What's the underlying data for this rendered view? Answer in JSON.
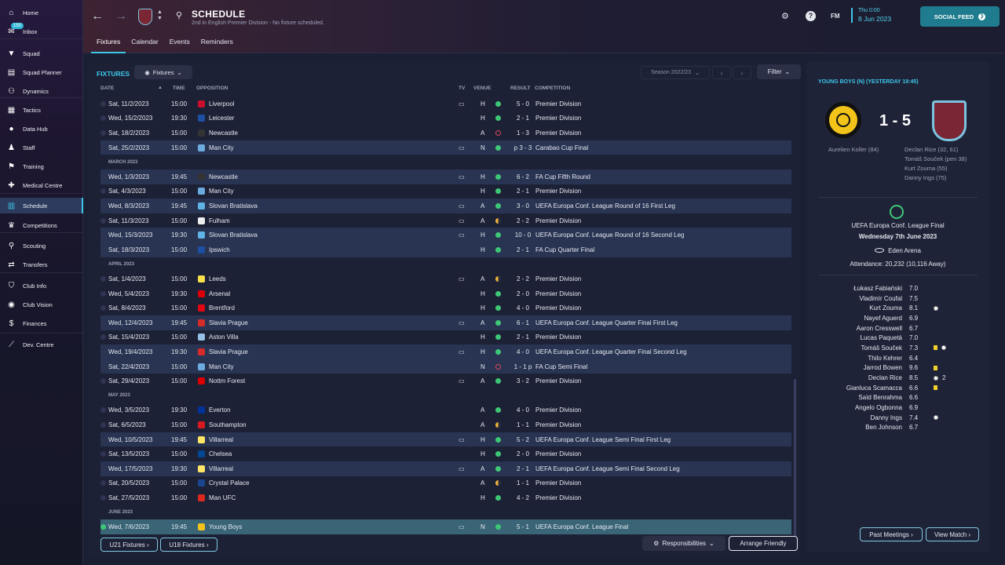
{
  "sidebar": {
    "items": [
      {
        "label": "Home",
        "icon": "home-icon"
      },
      {
        "label": "Inbox",
        "icon": "inbox-icon",
        "badge": "150"
      },
      {
        "label": "Squad",
        "icon": "shirt-icon"
      },
      {
        "label": "Squad Planner",
        "icon": "planner-icon"
      },
      {
        "label": "Dynamics",
        "icon": "dynamics-icon"
      },
      {
        "label": "Tactics",
        "icon": "tactics-icon"
      },
      {
        "label": "Data Hub",
        "icon": "data-hub-icon"
      },
      {
        "label": "Staff",
        "icon": "staff-icon"
      },
      {
        "label": "Training",
        "icon": "training-icon"
      },
      {
        "label": "Medical Centre",
        "icon": "medical-icon"
      },
      {
        "label": "Schedule",
        "icon": "calendar-icon",
        "active": true
      },
      {
        "label": "Competitions",
        "icon": "trophy-icon"
      },
      {
        "label": "Scouting",
        "icon": "scouting-icon"
      },
      {
        "label": "Transfers",
        "icon": "transfers-icon"
      },
      {
        "label": "Club Info",
        "icon": "shield-icon"
      },
      {
        "label": "Club Vision",
        "icon": "vision-icon"
      },
      {
        "label": "Finances",
        "icon": "finances-icon"
      },
      {
        "label": "Dev. Centre",
        "icon": "dev-centre-icon"
      }
    ]
  },
  "header": {
    "title": "SCHEDULE",
    "subtitle": "2nd in English Premier Division - No fixture scheduled.",
    "tabs": [
      "Fixtures",
      "Calendar",
      "Events",
      "Reminders"
    ],
    "fm_label": "FM",
    "time": "Thu 0:00",
    "date": "8 Jun 2023",
    "social_feed": "SOCIAL FEED"
  },
  "main": {
    "label": "FIXTURES",
    "dropdown": "Fixtures",
    "season": "Season 2022/23",
    "filter": "Filter",
    "columns": {
      "date": "DATE",
      "time": "TIME",
      "opposition": "OPPOSITION",
      "tv": "TV",
      "venue": "VENUE",
      "result": "RESULT",
      "competition": "COMPETITION"
    },
    "rows": [
      {
        "date": "Sat, 11/2/2023",
        "time": "15:00",
        "opp": "Liverpool",
        "tv": true,
        "venue": "H",
        "res": "win",
        "score": "5 - 0",
        "comp": "Premier Division",
        "crest": "#c8102e"
      },
      {
        "date": "Wed, 15/2/2023",
        "time": "19:30",
        "opp": "Leicester",
        "tv": false,
        "venue": "H",
        "res": "win",
        "score": "2 - 1",
        "comp": "Premier Division",
        "crest": "#1d4fa3"
      },
      {
        "date": "Sat, 18/2/2023",
        "time": "15:00",
        "opp": "Newcastle",
        "tv": false,
        "venue": "A",
        "res": "loss",
        "score": "1 - 3",
        "comp": "Premier Division",
        "crest": "#333333"
      },
      {
        "date": "Sat, 25/2/2023",
        "time": "15:00",
        "opp": "Man City",
        "tv": true,
        "venue": "N",
        "res": "win",
        "score": "p 3 - 3",
        "comp": "Carabao Cup Final",
        "crest": "#6cabdd"
      },
      {
        "month": "MARCH 2023"
      },
      {
        "date": "Wed, 1/3/2023",
        "time": "19:45",
        "opp": "Newcastle",
        "tv": true,
        "venue": "H",
        "res": "win",
        "score": "6 - 2",
        "comp": "FA Cup Fifth Round",
        "crest": "#333333"
      },
      {
        "date": "Sat, 4/3/2023",
        "time": "15:00",
        "opp": "Man City",
        "tv": false,
        "venue": "H",
        "res": "win",
        "score": "2 - 1",
        "comp": "Premier Division",
        "crest": "#6cabdd"
      },
      {
        "date": "Wed, 8/3/2023",
        "time": "19:45",
        "opp": "Slovan Bratislava",
        "tv": true,
        "venue": "A",
        "res": "win",
        "score": "3 - 0",
        "comp": "UEFA Europa Conf. League Round of 16  First Leg",
        "crest": "#5fb4e5"
      },
      {
        "date": "Sat, 11/3/2023",
        "time": "15:00",
        "opp": "Fulham",
        "tv": true,
        "venue": "A",
        "res": "draw",
        "score": "2 - 2",
        "comp": "Premier Division",
        "crest": "#eeeeee"
      },
      {
        "date": "Wed, 15/3/2023",
        "time": "19:30",
        "opp": "Slovan Bratislava",
        "tv": true,
        "venue": "H",
        "res": "win",
        "score": "10 - 0",
        "comp": "UEFA Europa Conf. League Round of 16  Second Leg",
        "crest": "#5fb4e5"
      },
      {
        "date": "Sat, 18/3/2023",
        "time": "15:00",
        "opp": "Ipswich",
        "tv": false,
        "venue": "H",
        "res": "win",
        "score": "2 - 1",
        "comp": "FA Cup Quarter Final",
        "crest": "#1d4fa3"
      },
      {
        "month": "APRIL 2023"
      },
      {
        "date": "Sat, 1/4/2023",
        "time": "15:00",
        "opp": "Leeds",
        "tv": true,
        "venue": "A",
        "res": "draw",
        "score": "2 - 2",
        "comp": "Premier Division",
        "crest": "#f5e04a"
      },
      {
        "date": "Wed, 5/4/2023",
        "time": "19:30",
        "opp": "Arsenal",
        "tv": false,
        "venue": "H",
        "res": "win",
        "score": "2 - 0",
        "comp": "Premier Division",
        "crest": "#db0007"
      },
      {
        "date": "Sat, 8/4/2023",
        "time": "15:00",
        "opp": "Brentford",
        "tv": false,
        "venue": "H",
        "res": "win",
        "score": "4 - 0",
        "comp": "Premier Division",
        "crest": "#e30613"
      },
      {
        "date": "Wed, 12/4/2023",
        "time": "19:45",
        "opp": "Slavia Prague",
        "tv": true,
        "venue": "A",
        "res": "win",
        "score": "6 - 1",
        "comp": "UEFA Europa Conf. League Quarter Final First Leg",
        "crest": "#d62b2b"
      },
      {
        "date": "Sat, 15/4/2023",
        "time": "15:00",
        "opp": "Aston Villa",
        "tv": false,
        "venue": "H",
        "res": "win",
        "score": "2 - 1",
        "comp": "Premier Division",
        "crest": "#95bfe5"
      },
      {
        "date": "Wed, 19/4/2023",
        "time": "19:30",
        "opp": "Slavia Prague",
        "tv": true,
        "venue": "H",
        "res": "win",
        "score": "4 - 0",
        "comp": "UEFA Europa Conf. League Quarter Final Second Leg",
        "crest": "#d62b2b"
      },
      {
        "date": "Sat, 22/4/2023",
        "time": "15:00",
        "opp": "Man City",
        "tv": false,
        "venue": "N",
        "res": "loss",
        "score": "1 - 1 p",
        "comp": "FA Cup Semi Final",
        "crest": "#6cabdd"
      },
      {
        "date": "Sat, 29/4/2023",
        "time": "15:00",
        "opp": "Nottm Forest",
        "tv": true,
        "venue": "A",
        "res": "win",
        "score": "3 - 2",
        "comp": "Premier Division",
        "crest": "#dd0000"
      },
      {
        "month": "MAY 2023"
      },
      {
        "date": "Wed, 3/5/2023",
        "time": "19:30",
        "opp": "Everton",
        "tv": false,
        "venue": "A",
        "res": "win",
        "score": "4 - 0",
        "comp": "Premier Division",
        "crest": "#003399"
      },
      {
        "date": "Sat, 6/5/2023",
        "time": "15:00",
        "opp": "Southampton",
        "tv": false,
        "venue": "A",
        "res": "draw",
        "score": "1 - 1",
        "comp": "Premier Division",
        "crest": "#d71920"
      },
      {
        "date": "Wed, 10/5/2023",
        "time": "19:45",
        "opp": "Villarreal",
        "tv": true,
        "venue": "H",
        "res": "win",
        "score": "5 - 2",
        "comp": "UEFA Europa Conf. League Semi Final First Leg",
        "crest": "#ffe667"
      },
      {
        "date": "Sat, 13/5/2023",
        "time": "15:00",
        "opp": "Chelsea",
        "tv": false,
        "venue": "H",
        "res": "win",
        "score": "2 - 0",
        "comp": "Premier Division",
        "crest": "#034694"
      },
      {
        "date": "Wed, 17/5/2023",
        "time": "19:30",
        "opp": "Villarreal",
        "tv": true,
        "venue": "A",
        "res": "win",
        "score": "2 - 1",
        "comp": "UEFA Europa Conf. League Semi Final Second Leg",
        "crest": "#ffe667"
      },
      {
        "date": "Sat, 20/5/2023",
        "time": "15:00",
        "opp": "Crystal Palace",
        "tv": false,
        "venue": "A",
        "res": "draw",
        "score": "1 - 1",
        "comp": "Premier Division",
        "crest": "#1b458f"
      },
      {
        "date": "Sat, 27/5/2023",
        "time": "15:00",
        "opp": "Man UFC",
        "tv": false,
        "venue": "H",
        "res": "win",
        "score": "4 - 2",
        "comp": "Premier Division",
        "crest": "#da291c"
      },
      {
        "month": "JUNE 2023"
      },
      {
        "date": "Wed, 7/6/2023",
        "time": "19:45",
        "opp": "Young Boys",
        "tv": true,
        "venue": "N",
        "res": "win",
        "score": "5 - 1",
        "comp": "UEFA Europa Conf. League Final",
        "crest": "#f2c419",
        "hl": true
      }
    ],
    "buttons": {
      "u21": "U21 Fixtures",
      "u18": "U18 Fixtures",
      "responsibilities": "Responsibilities",
      "arrange": "Arrange Friendly"
    }
  },
  "match": {
    "header": "YOUNG BOYS (N) (YESTERDAY 19:45)",
    "score": "1 - 5",
    "home_scorers": [
      "Aurelien Koller (84)"
    ],
    "away_scorers": [
      "Declan Rice (32, 61)",
      "Tomáš Souček (pen 38)",
      "Kurt Zouma (55)",
      "Danny Ings (75)"
    ],
    "competition": "UEFA Europa Conf. League Final",
    "date": "Wednesday 7th June 2023",
    "stadium": "Eden Arena",
    "attendance": "Attendance: 20,232 (10,116 Away)",
    "ratings": [
      {
        "name": "Łukasz Fabiański",
        "rating": "7.0"
      },
      {
        "name": "Vladimír Coufal",
        "rating": "7.5"
      },
      {
        "name": "Kurt Zouma",
        "rating": "8.1",
        "ball": true
      },
      {
        "name": "Nayef Aguerd",
        "rating": "6.9"
      },
      {
        "name": "Aaron Cresswell",
        "rating": "6.7"
      },
      {
        "name": "Lucas Paquetá",
        "rating": "7.0"
      },
      {
        "name": "Tomáš Souček",
        "rating": "7.3",
        "yellow": true,
        "ball": true
      },
      {
        "name": "Thilo Kehrer",
        "rating": "6.4"
      },
      {
        "name": "Jarrod Bowen",
        "rating": "9.6",
        "yellow": true
      },
      {
        "name": "Declan Rice",
        "rating": "8.5",
        "ball": true,
        "goals": "2"
      },
      {
        "name": "Gianluca Scamacca",
        "rating": "6.6",
        "yellow": true
      },
      {
        "name": "Saïd Benrahma",
        "rating": "6.6"
      },
      {
        "name": "Angelo Ogbonna",
        "rating": "6.9"
      },
      {
        "name": "Danny Ings",
        "rating": "7.4",
        "ball": true
      },
      {
        "name": "Ben Johnson",
        "rating": "6.7"
      }
    ],
    "past_meetings": "Past Meetings",
    "view_match": "View Match"
  }
}
